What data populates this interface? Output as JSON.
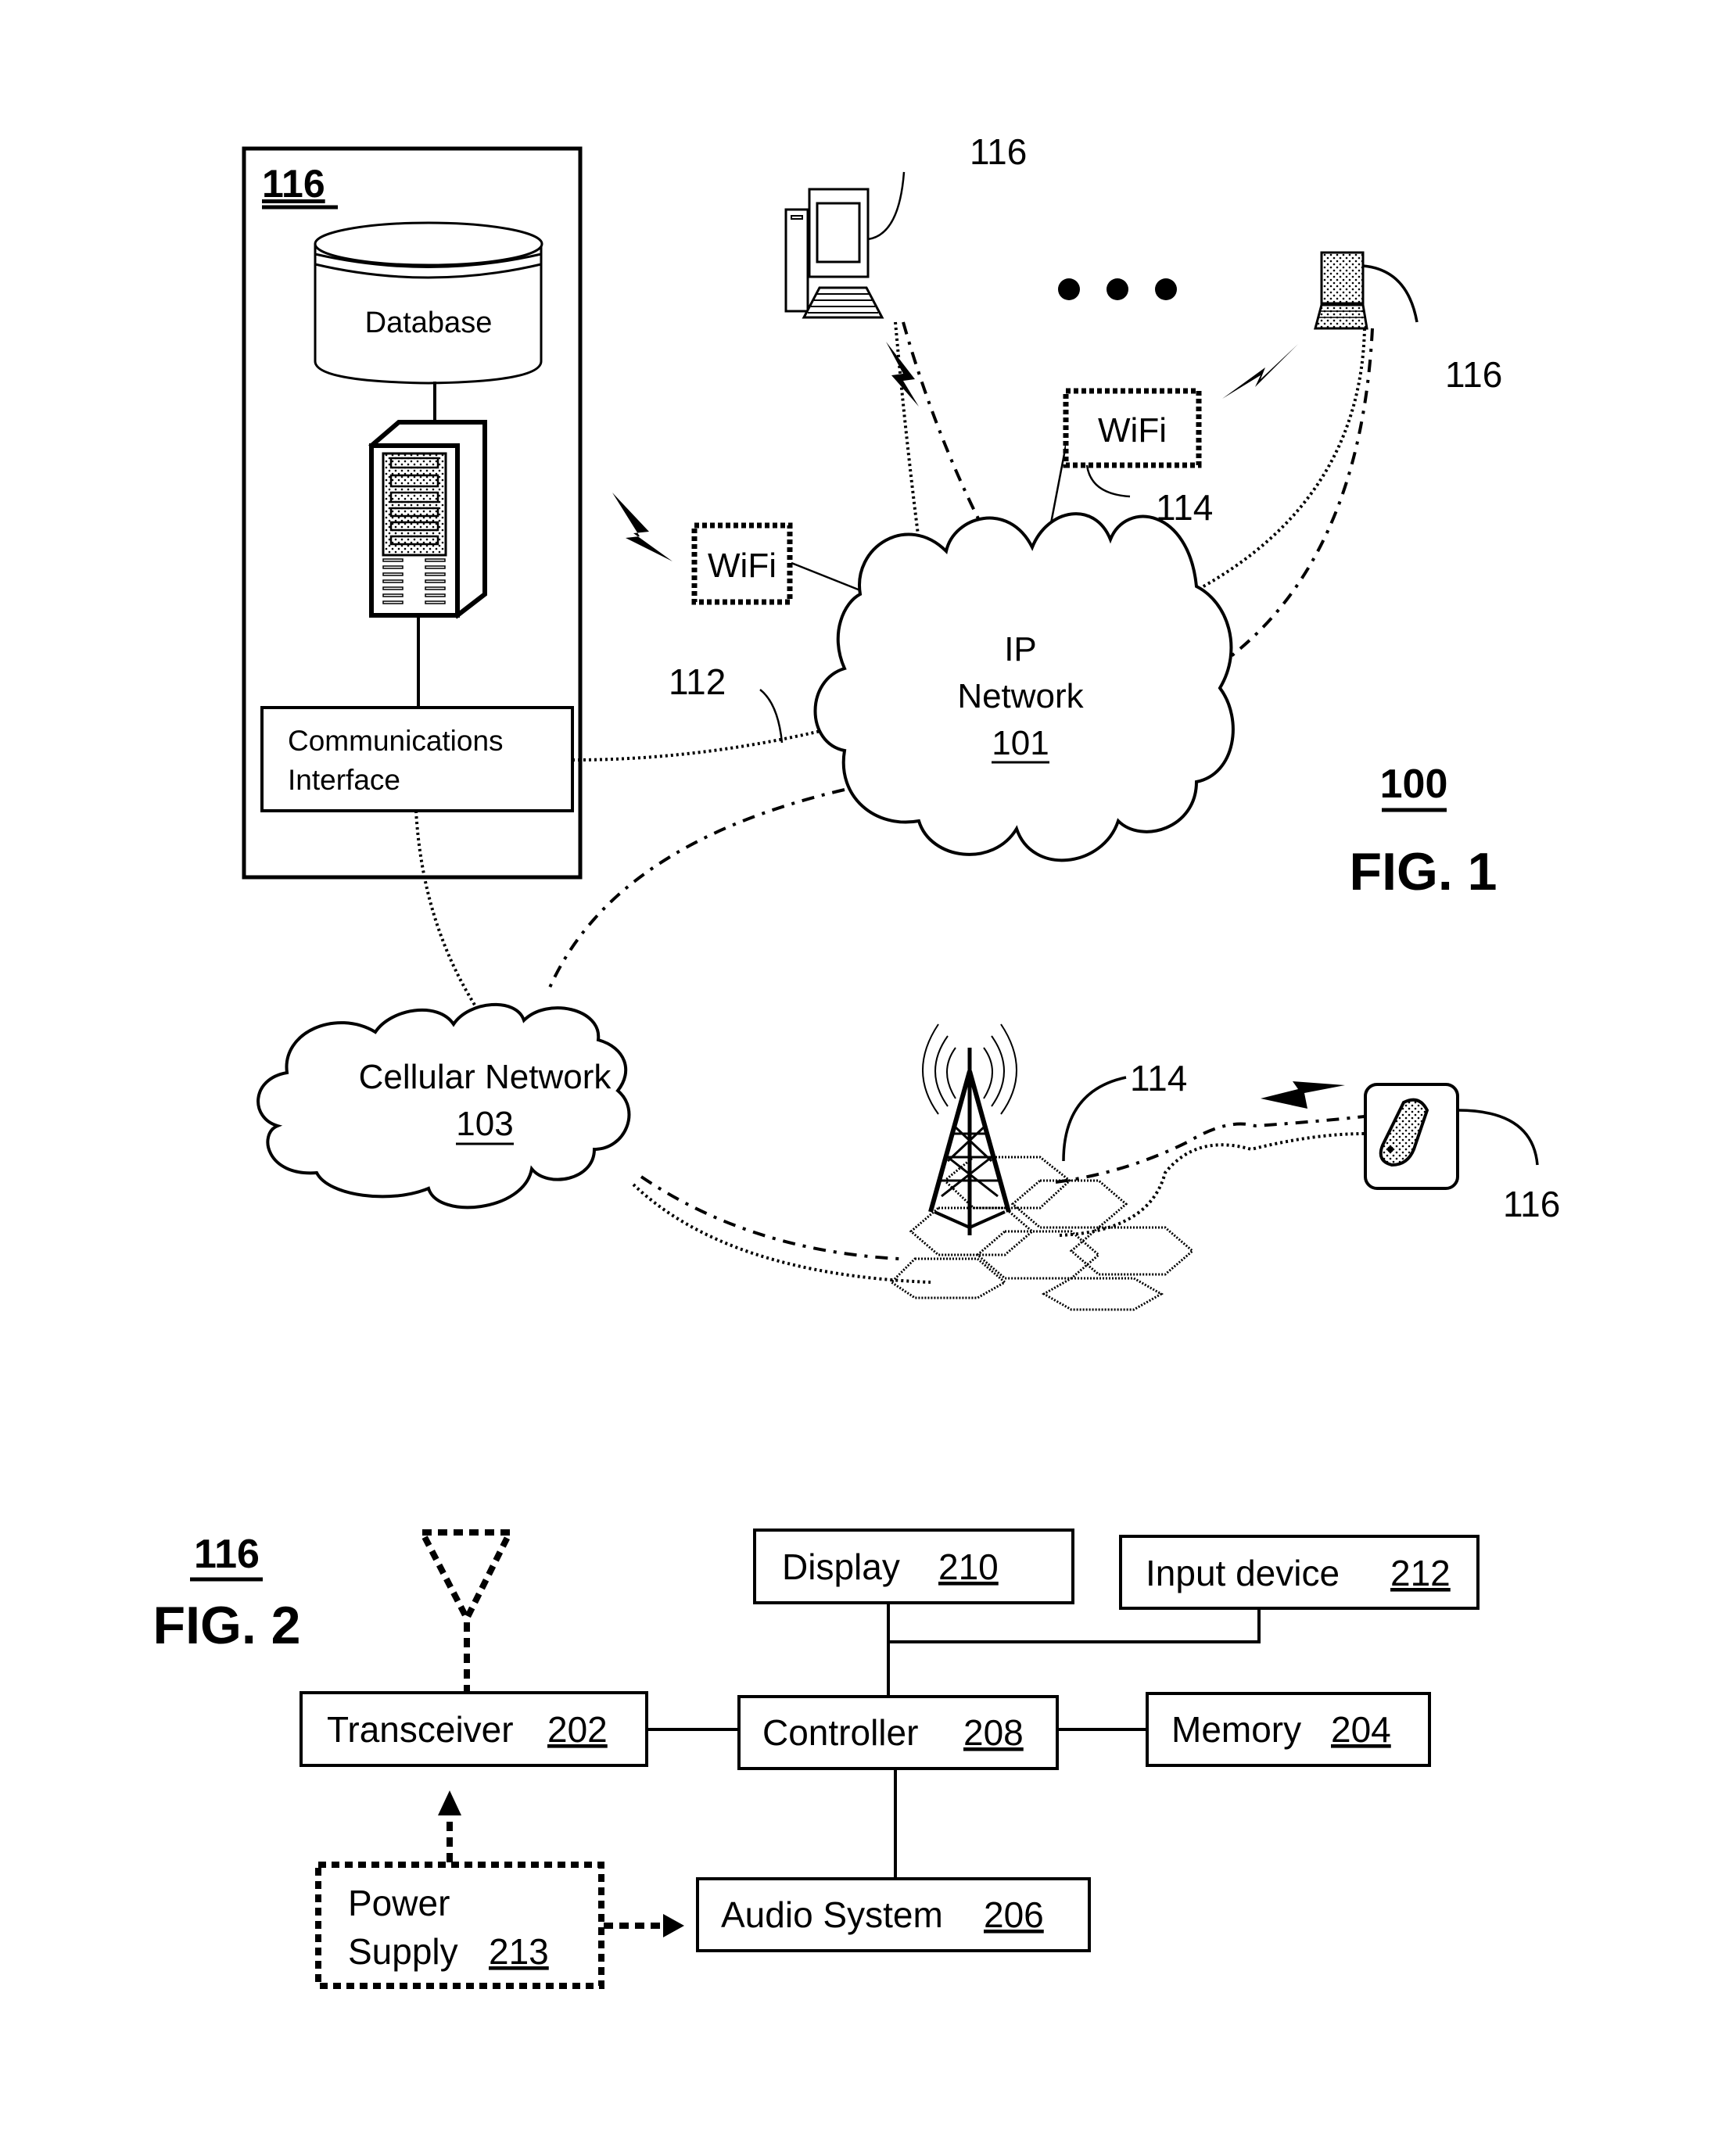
{
  "fig1": {
    "figure_label": "FIG. 1",
    "figure_ref": "100",
    "server_group": {
      "ref": "116",
      "database_label": "Database",
      "comm_interface_line1": "Communications",
      "comm_interface_line2": "Interface"
    },
    "ip_network": {
      "line1": "IP",
      "line2": "Network",
      "ref": "101"
    },
    "cellular_network": {
      "line1": "Cellular Network",
      "ref": "103"
    },
    "wifi_left": {
      "label": "WiFi"
    },
    "wifi_top": {
      "label": "WiFi",
      "ref": "114"
    },
    "link_ref": "112",
    "cell_ref": "114",
    "desktop_ref": "116",
    "laptop_ref": "116",
    "phone_ref": "116",
    "ellipsis": "• • •"
  },
  "fig2": {
    "figure_label": "FIG. 2",
    "figure_ref": "116",
    "blocks": {
      "display": {
        "label": "Display",
        "ref": "210"
      },
      "input_device": {
        "label": "Input device",
        "ref": "212"
      },
      "transceiver": {
        "label": "Transceiver",
        "ref": "202"
      },
      "controller": {
        "label": "Controller",
        "ref": "208"
      },
      "memory": {
        "label": "Memory",
        "ref": "204"
      },
      "audio_system": {
        "label": "Audio System",
        "ref": "206"
      },
      "power_supply": {
        "line1": "Power",
        "line2": "Supply",
        "ref": "213"
      }
    }
  }
}
